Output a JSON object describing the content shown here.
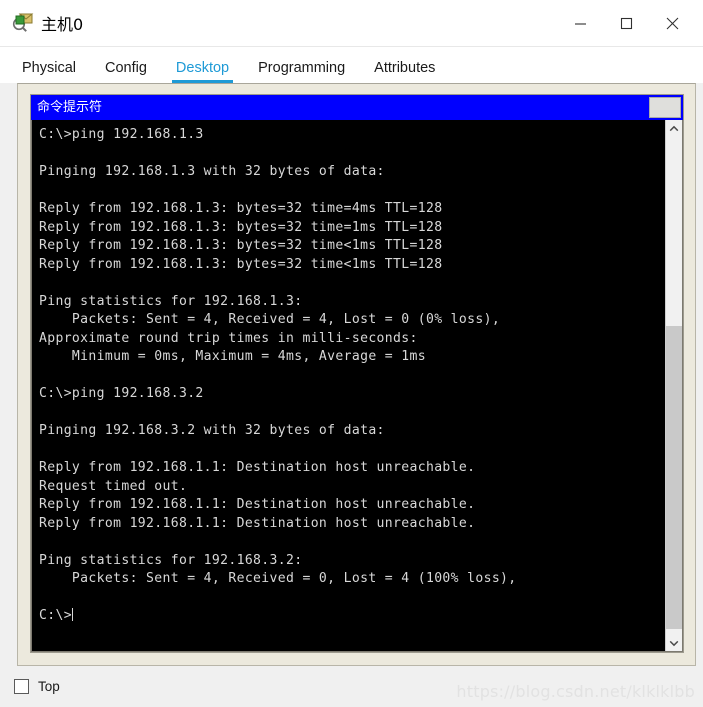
{
  "window": {
    "title": "主机0",
    "icon": "network-device-magnifier-icon",
    "controls": {
      "minimize": "minimize-icon",
      "maximize": "maximize-icon",
      "close": "close-icon"
    }
  },
  "tabs": [
    {
      "label": "Physical",
      "active": false
    },
    {
      "label": "Config",
      "active": false
    },
    {
      "label": "Desktop",
      "active": true
    },
    {
      "label": "Programming",
      "active": false
    },
    {
      "label": "Attributes",
      "active": false
    }
  ],
  "inner_window": {
    "title": "命令提示符",
    "button_label": ""
  },
  "terminal": {
    "prompt": "C:\\>",
    "lines": [
      "C:\\>ping 192.168.1.3",
      "",
      "Pinging 192.168.1.3 with 32 bytes of data:",
      "",
      "Reply from 192.168.1.3: bytes=32 time=4ms TTL=128",
      "Reply from 192.168.1.3: bytes=32 time=1ms TTL=128",
      "Reply from 192.168.1.3: bytes=32 time<1ms TTL=128",
      "Reply from 192.168.1.3: bytes=32 time<1ms TTL=128",
      "",
      "Ping statistics for 192.168.1.3:",
      "    Packets: Sent = 4, Received = 4, Lost = 0 (0% loss),",
      "Approximate round trip times in milli-seconds:",
      "    Minimum = 0ms, Maximum = 4ms, Average = 1ms",
      "",
      "C:\\>ping 192.168.3.2",
      "",
      "Pinging 192.168.3.2 with 32 bytes of data:",
      "",
      "Reply from 192.168.1.1: Destination host unreachable.",
      "Request timed out.",
      "Reply from 192.168.1.1: Destination host unreachable.",
      "Reply from 192.168.1.1: Destination host unreachable.",
      "",
      "Ping statistics for 192.168.3.2:",
      "    Packets: Sent = 4, Received = 0, Lost = 4 (100% loss),",
      ""
    ],
    "scrollbar": {
      "up_arrow": "chevron-up-icon",
      "down_arrow": "chevron-down-icon"
    }
  },
  "bottom": {
    "top_checkbox_label": "Top",
    "top_checkbox_checked": false
  },
  "watermark": "https://blog.csdn.net/klklklbb",
  "colors": {
    "accent_tab": "#1e9ad6",
    "inner_titlebar": "#0000ff",
    "panel_bg": "#ece9dd",
    "terminal_bg": "#000000",
    "terminal_fg": "#d8d8d8"
  }
}
